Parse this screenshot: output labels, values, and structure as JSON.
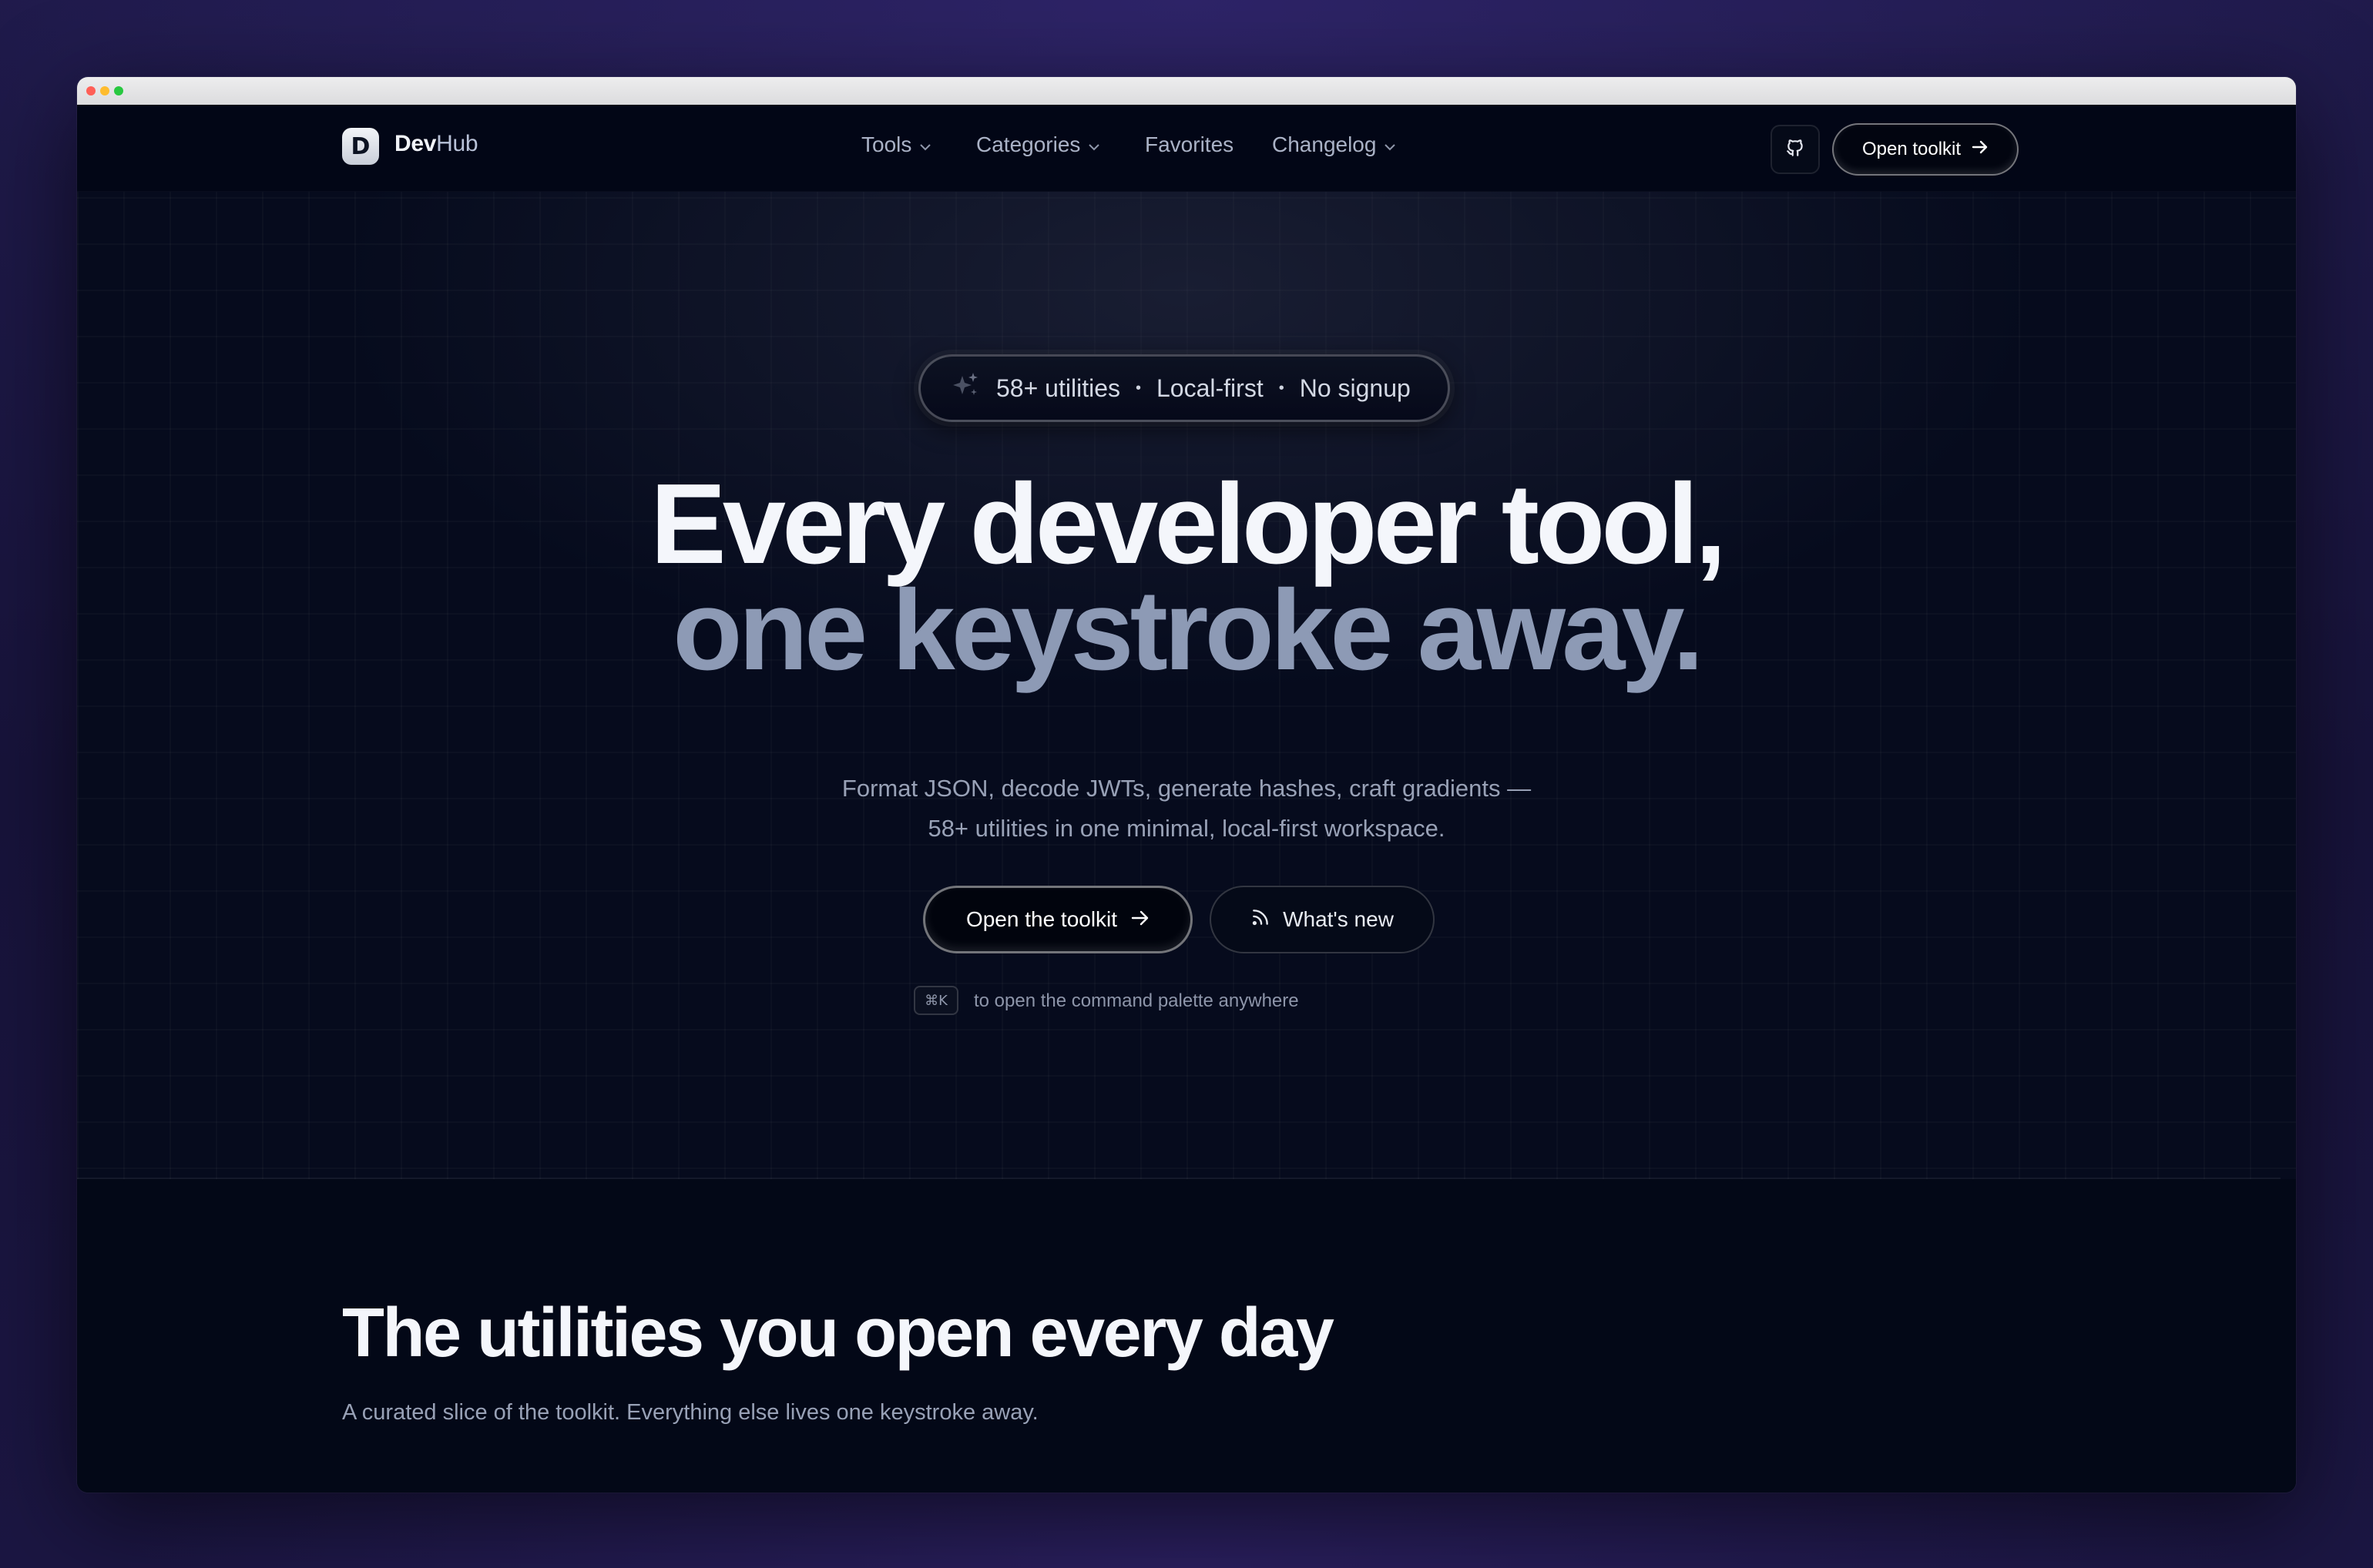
{
  "brand": {
    "name_primary": "Dev",
    "name_secondary": "Hub",
    "logo_letter": "D"
  },
  "nav": {
    "links": [
      {
        "label": "Tools",
        "has_dropdown": true
      },
      {
        "label": "Categories",
        "has_dropdown": true
      },
      {
        "label": "Favorites",
        "has_dropdown": false
      },
      {
        "label": "Changelog",
        "has_dropdown": true
      }
    ],
    "github_icon": "github-icon",
    "cta_label": "Open toolkit"
  },
  "hero": {
    "badge": {
      "part1": "58+ utilities",
      "part2": "Local-first",
      "part3": "No signup",
      "icon": "sparkles-icon"
    },
    "headline_line1": "Every developer tool,",
    "headline_line2": "one keystroke away.",
    "subtitle_line1": "Format JSON, decode JWTs, generate hashes, craft gradients —",
    "subtitle_line2": "58+ utilities in one minimal, local-first workspace.",
    "primary_cta": "Open the toolkit",
    "secondary_cta": "What's new",
    "shortcut_key": "⌘K",
    "shortcut_hint": "to open the command palette anywhere"
  },
  "section": {
    "title": "The utilities you open every day",
    "subtitle": "A curated slice of the toolkit. Everything else lives one keystroke away."
  },
  "colors": {
    "background": "#030817",
    "headline_primary": "#f4f6fb",
    "headline_secondary": "#8d9ab5",
    "muted_text": "#98a1b6"
  }
}
